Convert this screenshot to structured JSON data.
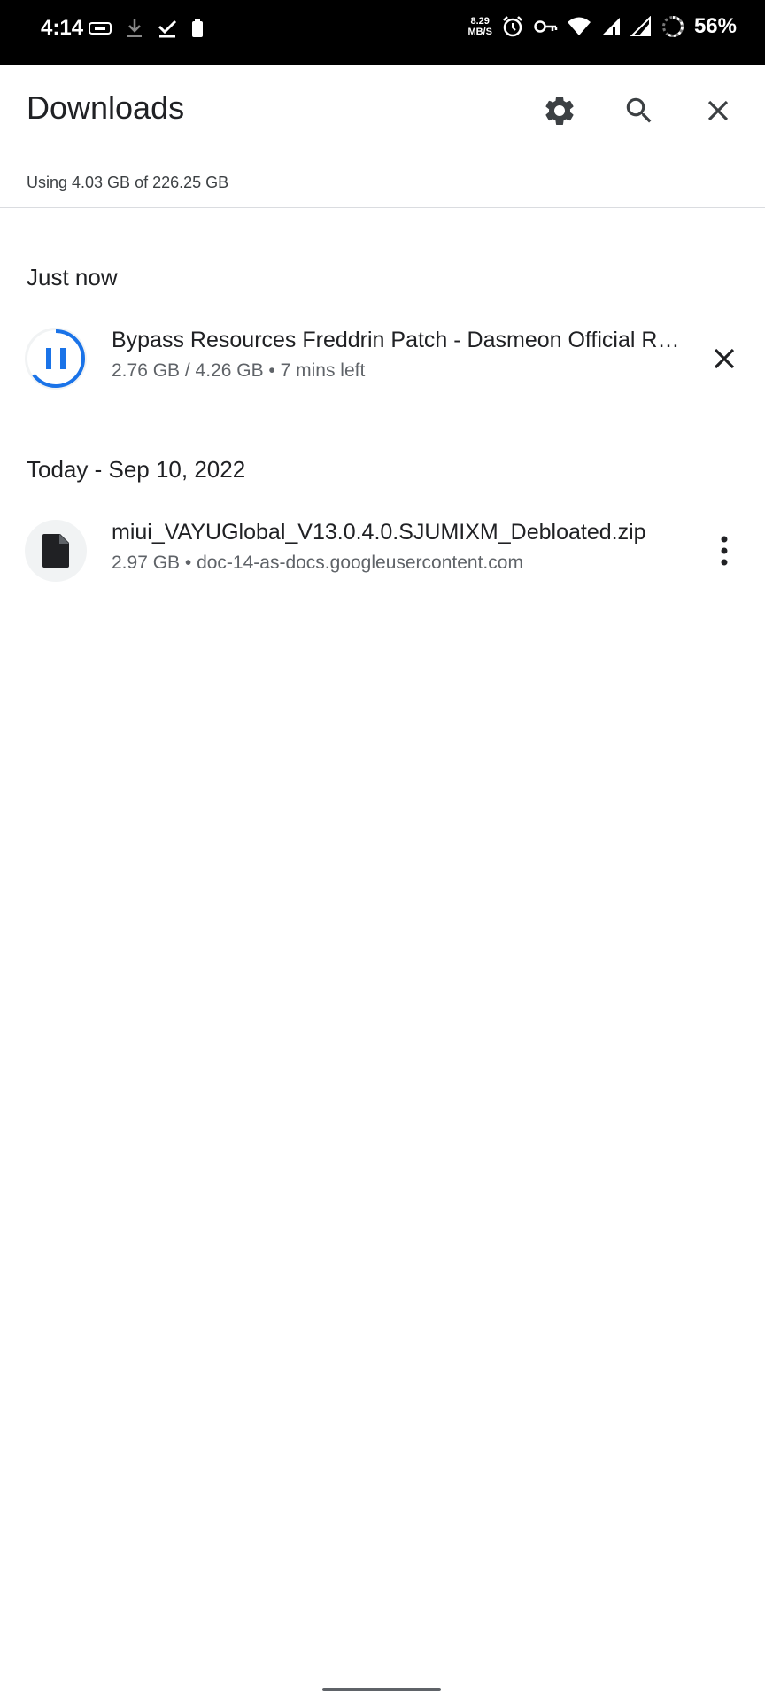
{
  "status_bar": {
    "time": "4:14",
    "network_speed_value": "8.29",
    "network_speed_unit": "MB/S",
    "battery_percent": "56%",
    "icons": [
      "sim-icon",
      "download-icon",
      "check-icon",
      "battery-small-icon",
      "alarm-icon",
      "vpn-key-icon",
      "wifi-icon",
      "signal-icon",
      "signal-icon",
      "battery-ring-icon"
    ]
  },
  "header": {
    "title": "Downloads",
    "icons": [
      "gear-icon",
      "search-icon",
      "close-icon"
    ]
  },
  "storage": {
    "text": "Using 4.03 GB of 226.25 GB"
  },
  "sections": [
    {
      "title": "Just now",
      "items": [
        {
          "title": "Bypass Resources Freddrin Patch - Dasmeon Official Release",
          "subtitle": "2.76 GB / 4.26 GB • 7 mins left",
          "icon": "pause-icon",
          "action_icon": "cancel-icon",
          "progress": 0.648
        }
      ]
    },
    {
      "title": "Today - Sep 10, 2022",
      "items": [
        {
          "title": "miui_VAYUGlobal_V13.0.4.0.SJUMIXM_Debloated.zip",
          "subtitle": "2.97 GB • doc-14-as-docs.googleusercontent.com",
          "icon": "file-icon",
          "action_icon": "more-vert-icon"
        }
      ]
    }
  ],
  "colors": {
    "accent": "#1a73e8",
    "text_primary": "#202124",
    "text_secondary": "#5f6368"
  }
}
